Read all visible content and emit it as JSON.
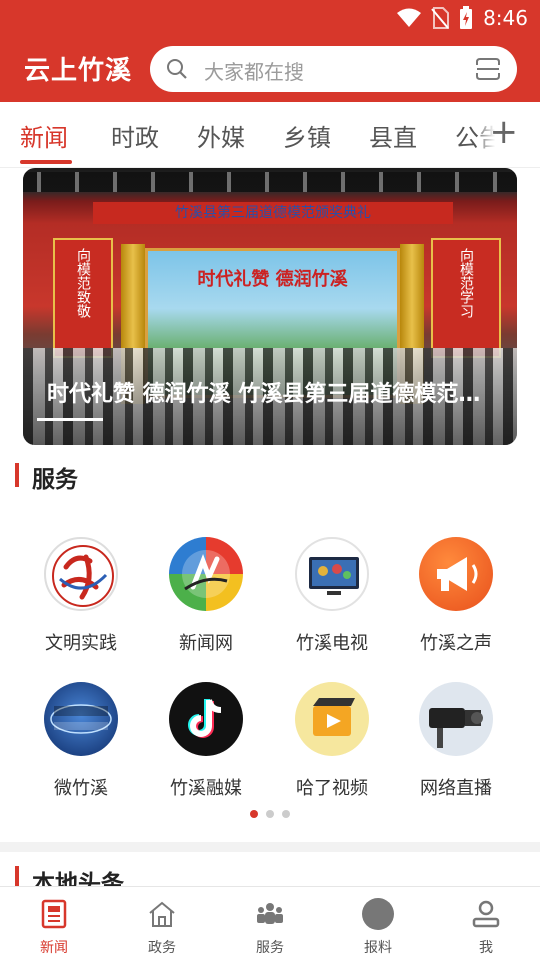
{
  "status_bar": {
    "time": "8:46",
    "icons": [
      "wifi-icon",
      "no-sim-icon",
      "battery-charging-icon"
    ]
  },
  "header": {
    "app_title": "云上竹溪",
    "search_placeholder": "大家都在搜"
  },
  "tabs": [
    {
      "label": "新闻",
      "active": true
    },
    {
      "label": "时政",
      "active": false
    },
    {
      "label": "外媒",
      "active": false
    },
    {
      "label": "乡镇",
      "active": false
    },
    {
      "label": "县直",
      "active": false
    },
    {
      "label": "公告",
      "active": false
    }
  ],
  "banner": {
    "caption": "时代礼赞 德润竹溪 竹溪县第三届道德模范颁奖典礼",
    "sign_text": "竹溪县第三届道德模范颁奖典礼",
    "screen_text": "时代礼赞 德润竹溪",
    "left_banner_text": "向模范致敬",
    "right_banner_text": "向模范学习"
  },
  "services": {
    "title": "服务",
    "items": [
      {
        "label": "文明实践",
        "icon": "civilization-practice-icon"
      },
      {
        "label": "新闻网",
        "icon": "news-website-icon"
      },
      {
        "label": "竹溪电视",
        "icon": "tv-icon"
      },
      {
        "label": "竹溪之声",
        "icon": "megaphone-icon"
      },
      {
        "label": "微竹溪",
        "icon": "wechat-zhuxi-icon"
      },
      {
        "label": "竹溪融媒",
        "icon": "tiktok-icon"
      },
      {
        "label": "哈了视频",
        "icon": "video-player-icon"
      },
      {
        "label": "网络直播",
        "icon": "live-camera-icon"
      }
    ],
    "page_dots": 3,
    "active_page": 1
  },
  "local_headlines": {
    "title": "本地头条"
  },
  "bottom_nav": [
    {
      "label": "新闻",
      "icon": "newspaper-icon",
      "active": true
    },
    {
      "label": "政务",
      "icon": "home-icon",
      "active": false
    },
    {
      "label": "服务",
      "icon": "people-icon",
      "active": false
    },
    {
      "label": "报料",
      "icon": "report-icon",
      "active": false
    },
    {
      "label": "我",
      "icon": "user-icon",
      "active": false
    }
  ],
  "colors": {
    "brand_red": "#d7372b",
    "text_dark": "#222222",
    "text_gray": "#555555"
  }
}
